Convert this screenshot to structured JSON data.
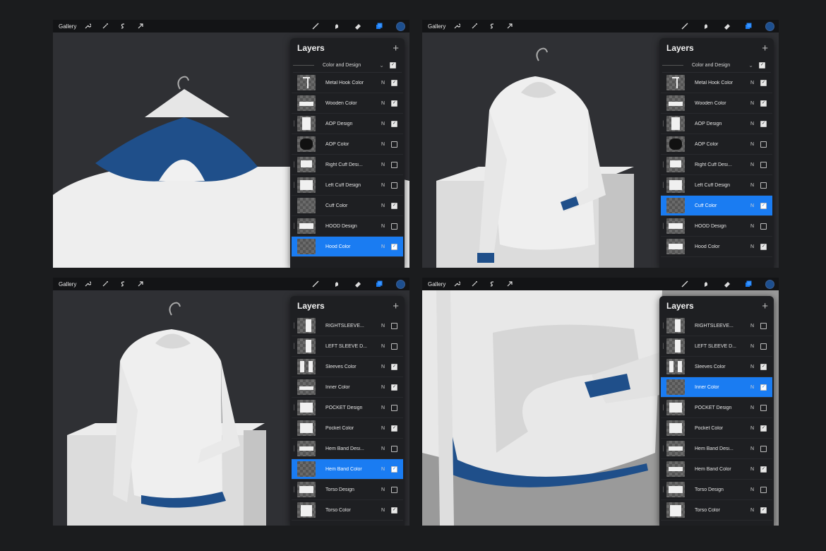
{
  "toolbar": {
    "gallery_label": "Gallery"
  },
  "panel": {
    "title": "Layers",
    "add_symbol": "+"
  },
  "screens": [
    {
      "group": {
        "name": "Color and Design"
      },
      "layers": [
        {
          "name": "Metal Hook Color",
          "blend": "N",
          "checked": true,
          "selected": false,
          "clipped": false,
          "thumb": "hook"
        },
        {
          "name": "Wooden Color",
          "blend": "N",
          "checked": true,
          "selected": false,
          "clipped": false,
          "thumb": "hanger"
        },
        {
          "name": "AOP Design",
          "blend": "N",
          "checked": true,
          "selected": false,
          "clipped": true,
          "thumb": "torso"
        },
        {
          "name": "AOP Color",
          "blend": "N",
          "checked": false,
          "selected": false,
          "clipped": false,
          "thumb": "dark"
        },
        {
          "name": "Right Cuff Desi...",
          "blend": "N",
          "checked": false,
          "selected": false,
          "clipped": true,
          "thumb": "cuff"
        },
        {
          "name": "Left Cuff Design",
          "blend": "N",
          "checked": false,
          "selected": false,
          "clipped": true,
          "thumb": "cuff2"
        },
        {
          "name": "Cuff Color",
          "blend": "N",
          "checked": true,
          "selected": false,
          "clipped": false,
          "thumb": "blank"
        },
        {
          "name": "HOOD Design",
          "blend": "N",
          "checked": false,
          "selected": false,
          "clipped": true,
          "thumb": "hood"
        },
        {
          "name": "Hood Color",
          "blend": "N",
          "checked": true,
          "selected": true,
          "clipped": false,
          "thumb": "blank"
        }
      ]
    },
    {
      "group": {
        "name": "Color and Design"
      },
      "layers": [
        {
          "name": "Metal Hook Color",
          "blend": "N",
          "checked": true,
          "selected": false,
          "clipped": false,
          "thumb": "hook"
        },
        {
          "name": "Wooden Color",
          "blend": "N",
          "checked": true,
          "selected": false,
          "clipped": false,
          "thumb": "hanger"
        },
        {
          "name": "AOP Design",
          "blend": "N",
          "checked": true,
          "selected": false,
          "clipped": true,
          "thumb": "torso"
        },
        {
          "name": "AOP Color",
          "blend": "N",
          "checked": false,
          "selected": false,
          "clipped": false,
          "thumb": "dark"
        },
        {
          "name": "Right Cuff Desi...",
          "blend": "N",
          "checked": false,
          "selected": false,
          "clipped": true,
          "thumb": "cuff"
        },
        {
          "name": "Left Cuff Design",
          "blend": "N",
          "checked": false,
          "selected": false,
          "clipped": true,
          "thumb": "cuff2"
        },
        {
          "name": "Cuff Color",
          "blend": "N",
          "checked": true,
          "selected": true,
          "clipped": false,
          "thumb": "blank"
        },
        {
          "name": "HOOD Design",
          "blend": "N",
          "checked": false,
          "selected": false,
          "clipped": true,
          "thumb": "hood"
        },
        {
          "name": "Hood Color",
          "blend": "N",
          "checked": true,
          "selected": false,
          "clipped": false,
          "thumb": "hood"
        }
      ]
    },
    {
      "group": null,
      "layers": [
        {
          "name": "RIGHTSLEEVE...",
          "blend": "N",
          "checked": false,
          "selected": false,
          "clipped": true,
          "thumb": "sleeve"
        },
        {
          "name": "LEFT SLEEVE D...",
          "blend": "N",
          "checked": false,
          "selected": false,
          "clipped": true,
          "thumb": "sleeve"
        },
        {
          "name": "Sleeves Color",
          "blend": "N",
          "checked": true,
          "selected": false,
          "clipped": false,
          "thumb": "sleeves"
        },
        {
          "name": "Inner Color",
          "blend": "N",
          "checked": true,
          "selected": false,
          "clipped": false,
          "thumb": "inner"
        },
        {
          "name": "POCKET Design",
          "blend": "N",
          "checked": false,
          "selected": false,
          "clipped": true,
          "thumb": "pocket"
        },
        {
          "name": "Pocket Color",
          "blend": "N",
          "checked": true,
          "selected": false,
          "clipped": false,
          "thumb": "pocket"
        },
        {
          "name": "Hem Band Desi...",
          "blend": "N",
          "checked": false,
          "selected": false,
          "clipped": true,
          "thumb": "band"
        },
        {
          "name": "Hem Band Color",
          "blend": "N",
          "checked": true,
          "selected": true,
          "clipped": false,
          "thumb": "blank"
        },
        {
          "name": "Torso Design",
          "blend": "N",
          "checked": false,
          "selected": false,
          "clipped": true,
          "thumb": "logo"
        },
        {
          "name": "Torso Color",
          "blend": "N",
          "checked": true,
          "selected": false,
          "clipped": false,
          "thumb": "shirt"
        }
      ]
    },
    {
      "group": null,
      "layers": [
        {
          "name": "RIGHTSLEEVE...",
          "blend": "N",
          "checked": false,
          "selected": false,
          "clipped": true,
          "thumb": "sleeve"
        },
        {
          "name": "LEFT SLEEVE D...",
          "blend": "N",
          "checked": false,
          "selected": false,
          "clipped": true,
          "thumb": "sleeve"
        },
        {
          "name": "Sleeves Color",
          "blend": "N",
          "checked": true,
          "selected": false,
          "clipped": false,
          "thumb": "sleeves"
        },
        {
          "name": "Inner Color",
          "blend": "N",
          "checked": true,
          "selected": true,
          "clipped": false,
          "thumb": "blank"
        },
        {
          "name": "POCKET Design",
          "blend": "N",
          "checked": false,
          "selected": false,
          "clipped": true,
          "thumb": "pocket"
        },
        {
          "name": "Pocket Color",
          "blend": "N",
          "checked": true,
          "selected": false,
          "clipped": false,
          "thumb": "pocket"
        },
        {
          "name": "Hem Band Desi...",
          "blend": "N",
          "checked": false,
          "selected": false,
          "clipped": true,
          "thumb": "band"
        },
        {
          "name": "Hem Band Color",
          "blend": "N",
          "checked": true,
          "selected": false,
          "clipped": false,
          "thumb": "band"
        },
        {
          "name": "Torso Design",
          "blend": "N",
          "checked": false,
          "selected": false,
          "clipped": true,
          "thumb": "logo"
        },
        {
          "name": "Torso Color",
          "blend": "N",
          "checked": true,
          "selected": false,
          "clipped": false,
          "thumb": "shirt"
        }
      ]
    }
  ],
  "colors": {
    "selected_row": "#1a7cf2",
    "accent_navy": "#1d4f8f"
  },
  "icons": [
    "wrench-icon",
    "magic-wand-icon",
    "selection-icon",
    "transform-arrow-icon",
    "brush-icon",
    "smudge-icon",
    "eraser-icon",
    "layers-icon",
    "color-swatch-icon"
  ]
}
